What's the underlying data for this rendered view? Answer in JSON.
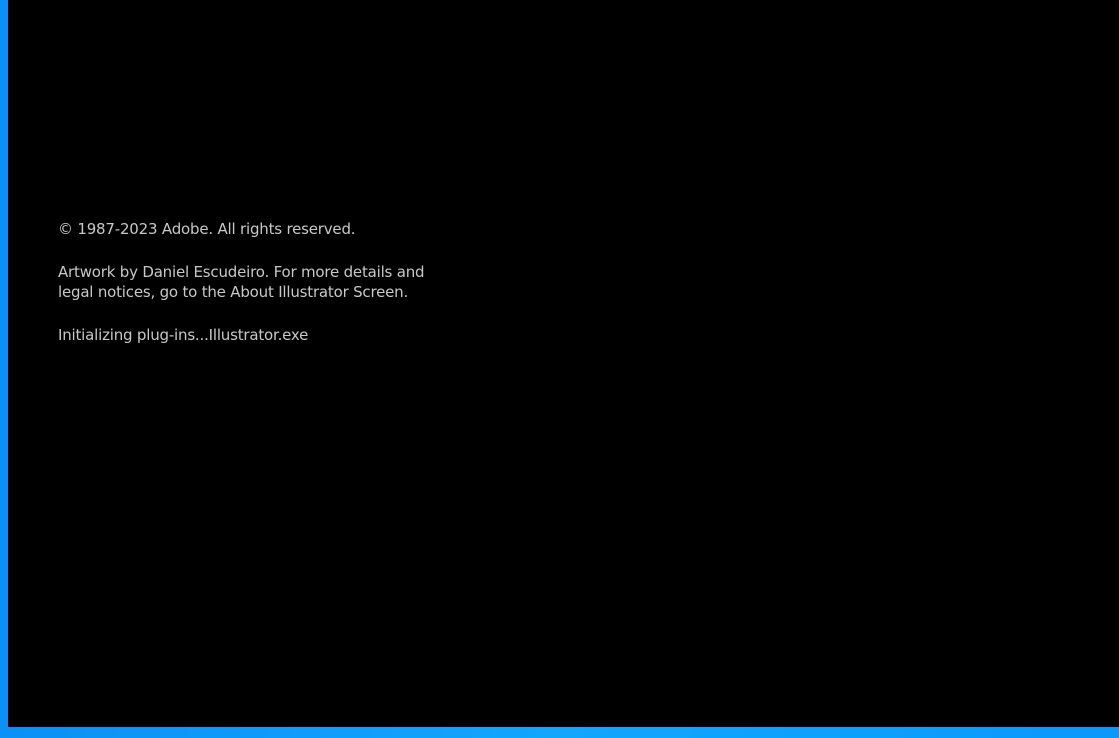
{
  "splash": {
    "copyright": "© 1987-2023 Adobe. All rights reserved.",
    "artwork_credit": "Artwork by Daniel Escudeiro. For more details and legal notices, go to the About Illustrator Screen.",
    "status": "Initializing plug-ins...Illustrator.exe"
  },
  "colors": {
    "splash_background": "#000000",
    "text": "#c8c8c8",
    "desktop_accent": "#0a9bff"
  }
}
